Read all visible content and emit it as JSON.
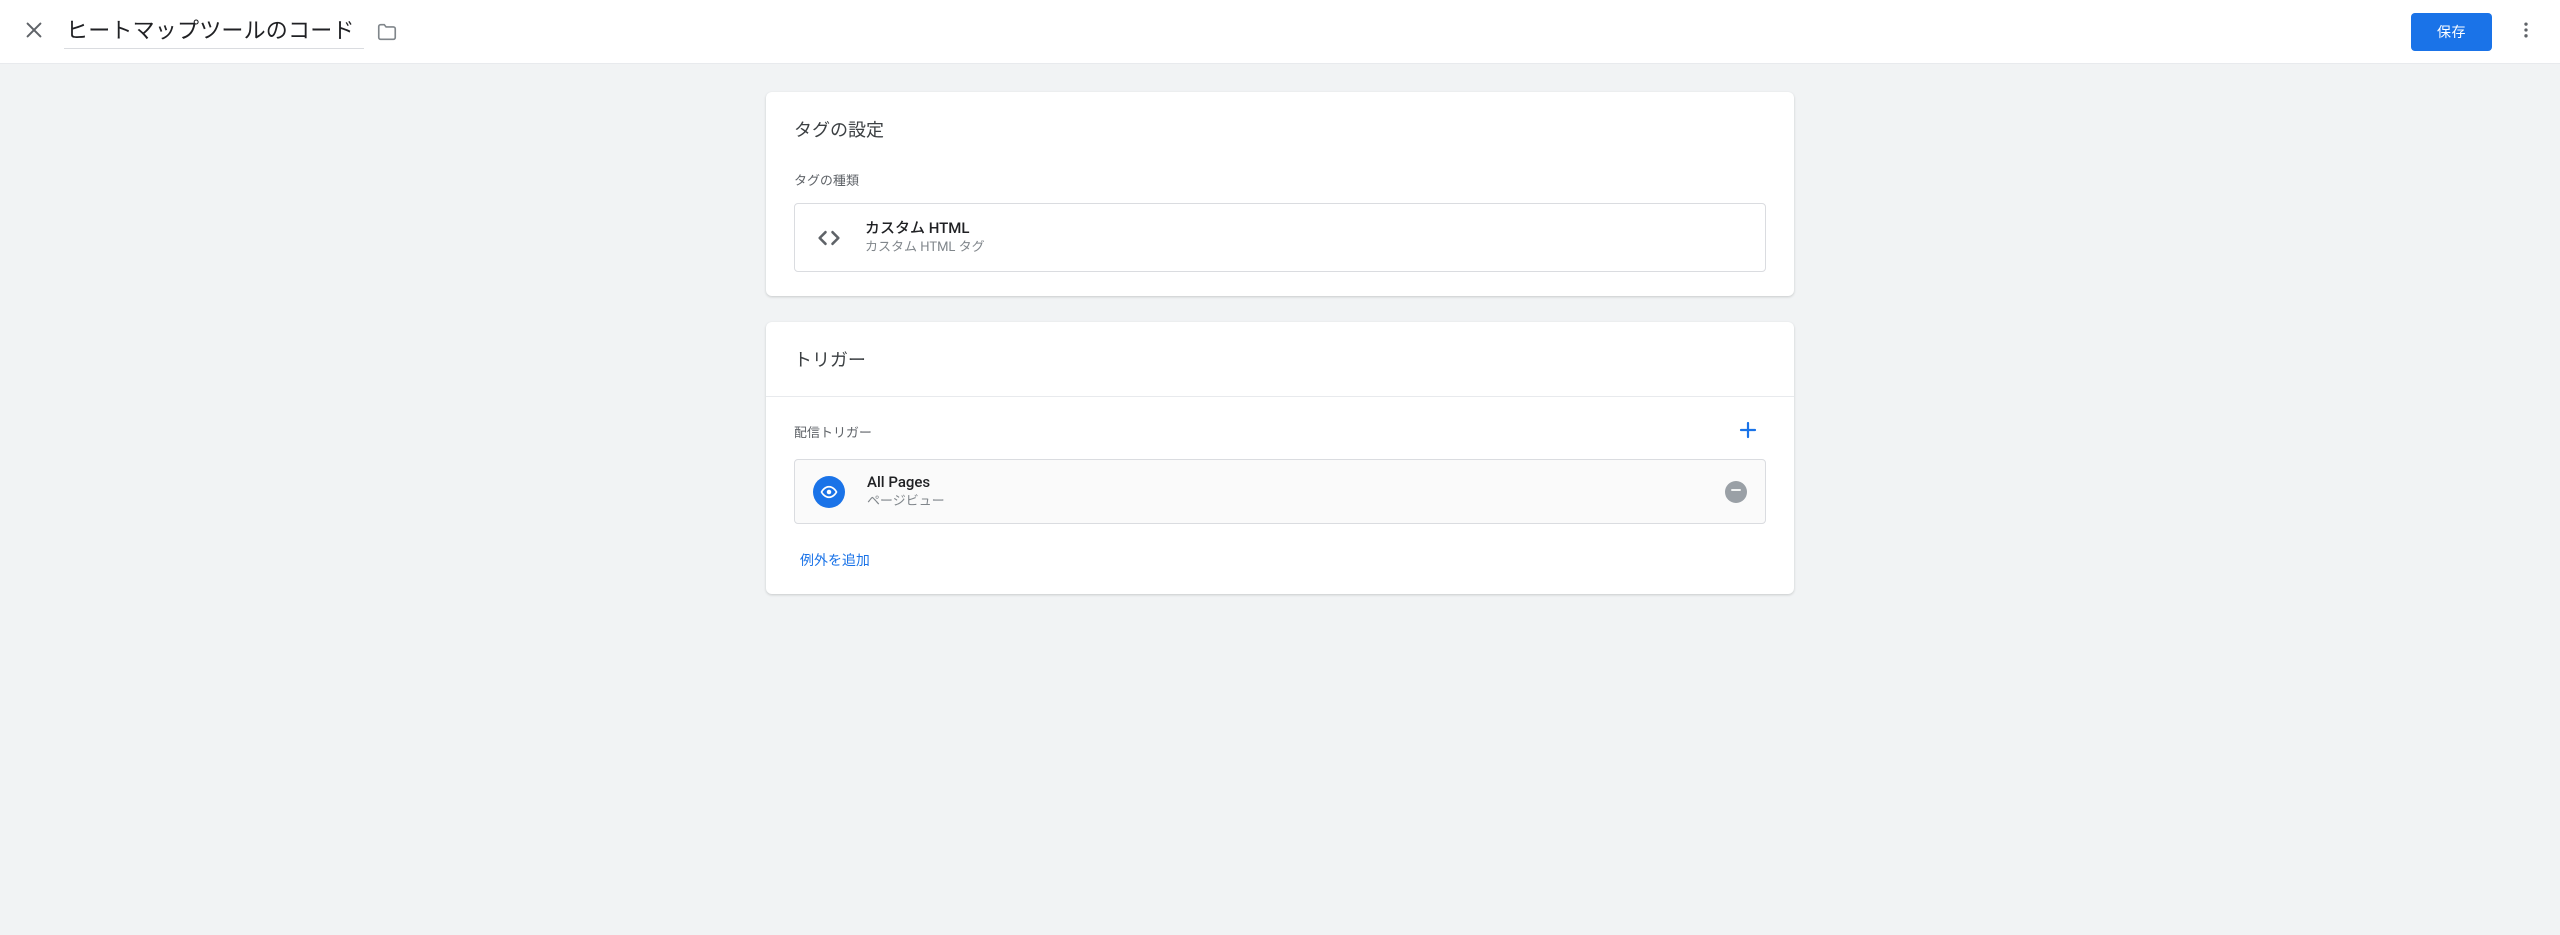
{
  "header": {
    "title_value": "ヒートマップツールのコード",
    "save_label": "保存"
  },
  "tag_config": {
    "section_title": "タグの設定",
    "type_label": "タグの種類",
    "tag_type_name": "カスタム HTML",
    "tag_type_desc": "カスタム HTML タグ"
  },
  "trigger": {
    "section_title": "トリガー",
    "firing_label": "配信トリガー",
    "item": {
      "name": "All Pages",
      "desc": "ページビュー"
    },
    "add_exception_label": "例外を追加"
  }
}
